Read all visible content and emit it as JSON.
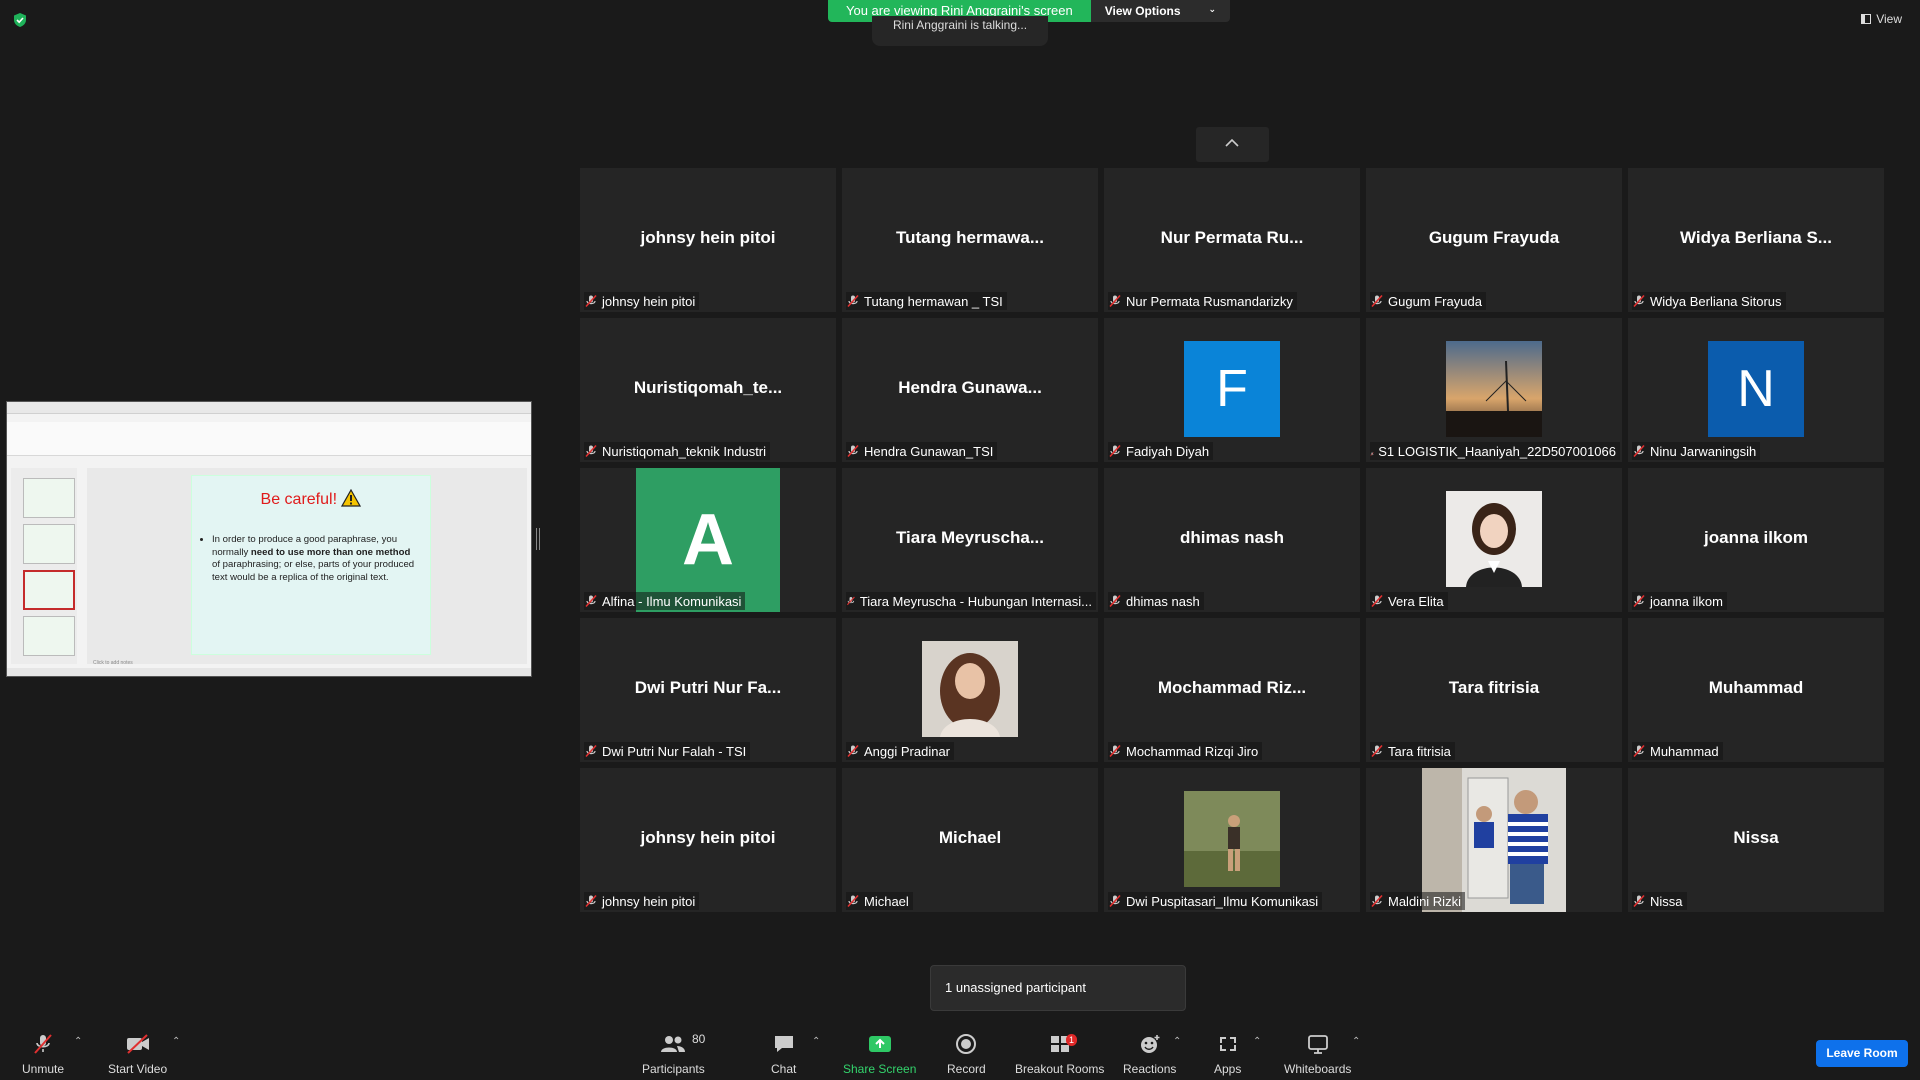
{
  "banner": {
    "viewing_text": "You are viewing Rini Anggraini's screen",
    "view_options": "View Options",
    "talking": "Rini Anggraini is talking..."
  },
  "top_right": {
    "view_label": "View"
  },
  "shared_slide": {
    "title": "Be careful!",
    "warning_icon": "warning-triangle-icon",
    "bullet_pre": "In order to produce a good paraphrase, you normally ",
    "bullet_bold": "need to use more than one method",
    "bullet_post": " of paraphrasing; or else, parts of your produced text would be a replica of the original text.",
    "notes_placeholder": "Click to add notes"
  },
  "participants": [
    {
      "display": "johnsy hein pitoi",
      "name": "johnsy hein pitoi"
    },
    {
      "display": "Tutang  hermawa...",
      "name": "Tutang hermawan _ TSI"
    },
    {
      "display": "Nur Permata Ru...",
      "name": "Nur Permata Rusmandarizky"
    },
    {
      "display": "Gugum Frayuda",
      "name": "Gugum Frayuda"
    },
    {
      "display": "Widya Berliana S...",
      "name": "Widya Berliana Sitorus"
    },
    {
      "display": "Nuristiqomah_te...",
      "name": "Nuristiqomah_teknik Industri"
    },
    {
      "display": "Hendra  Gunawa...",
      "name": "Hendra Gunawan_TSI"
    },
    {
      "display": "F",
      "name": "Fadiyah Diyah"
    },
    {
      "display": "",
      "name": "S1 LOGISTIK_Haaniyah_22D507001066"
    },
    {
      "display": "N",
      "name": "Ninu Jarwaningsih"
    },
    {
      "display": "A",
      "name": "Alfina - Ilmu Komunikasi"
    },
    {
      "display": "Tiara  Meyruscha...",
      "name": "Tiara Meyruscha - Hubungan Internasi..."
    },
    {
      "display": "dhimas nash",
      "name": "dhimas nash"
    },
    {
      "display": "",
      "name": "Vera Elita"
    },
    {
      "display": "joanna ilkom",
      "name": "joanna ilkom"
    },
    {
      "display": "Dwi Putri Nur Fa...",
      "name": "Dwi Putri Nur Falah - TSI"
    },
    {
      "display": "",
      "name": "Anggi Pradinar"
    },
    {
      "display": "Mochammad  Riz...",
      "name": "Mochammad Rizqi Jiro"
    },
    {
      "display": "Tara fitrisia",
      "name": "Tara fitrisia"
    },
    {
      "display": "Muhammad",
      "name": "Muhammad"
    },
    {
      "display": "johnsy hein pitoi",
      "name": "johnsy hein pitoi"
    },
    {
      "display": "Michael",
      "name": "Michael"
    },
    {
      "display": "",
      "name": "Dwi Puspitasari_Ilmu Komunikasi"
    },
    {
      "display": "",
      "name": "Maldini Rizki"
    },
    {
      "display": "Nissa",
      "name": "Nissa"
    }
  ],
  "popup": {
    "text": "1 unassigned participant"
  },
  "toolbar": {
    "unmute": "Unmute",
    "start_video": "Start Video",
    "participants": "Participants",
    "participant_count": "80",
    "chat": "Chat",
    "share_screen": "Share Screen",
    "record": "Record",
    "breakout_rooms": "Breakout Rooms",
    "breakout_badge": "1",
    "reactions": "Reactions",
    "apps": "Apps",
    "whiteboards": "Whiteboards",
    "leave": "Leave Room"
  },
  "colors": {
    "accent_green": "#22b65a",
    "leave_blue": "#0e71eb",
    "avatar_f": "#0a84d8",
    "avatar_n": "#0b5cad",
    "avatar_a": "#2e9e63"
  }
}
